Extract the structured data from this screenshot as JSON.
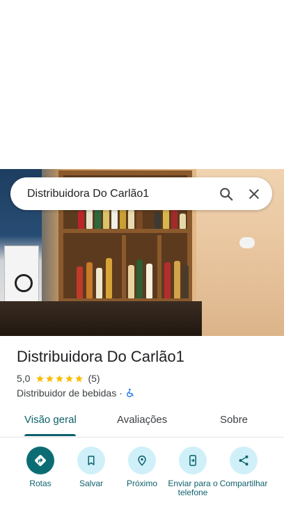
{
  "search": {
    "query": "Distribuidora Do Carlão1"
  },
  "place": {
    "title": "Distribuidora Do Carlão1",
    "rating": "5,0",
    "stars": 5,
    "review_count": "(5)",
    "category": "Distribuidor de bebidas",
    "separator": "·"
  },
  "tabs": [
    {
      "label": "Visão geral",
      "active": true
    },
    {
      "label": "Avaliações",
      "active": false
    },
    {
      "label": "Sobre",
      "active": false
    }
  ],
  "actions": [
    {
      "label": "Rotas",
      "icon": "directions-icon",
      "primary": true
    },
    {
      "label": "Salvar",
      "icon": "bookmark-icon",
      "primary": false
    },
    {
      "label": "Próximo",
      "icon": "nearby-icon",
      "primary": false
    },
    {
      "label": "Enviar para o telefone",
      "icon": "send-to-phone-icon",
      "primary": false
    },
    {
      "label": "Compartilhar",
      "icon": "share-icon",
      "primary": false
    }
  ],
  "colors": {
    "accent": "#0b5f6b",
    "primary_button": "#0b6d73",
    "button_tint": "#cff0f8",
    "star": "#fbbc04"
  }
}
